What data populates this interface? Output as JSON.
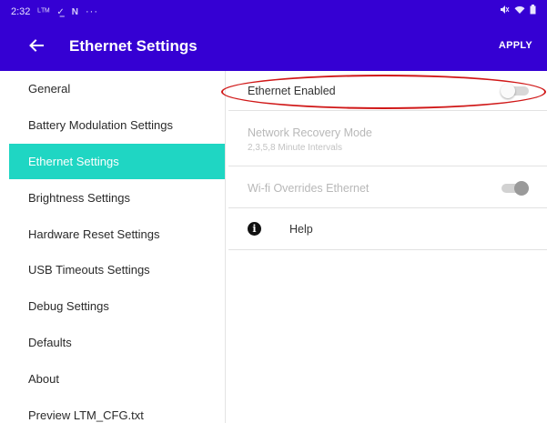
{
  "status_bar": {
    "time": "2:32",
    "indicators": [
      "ltm-icon",
      "check-download-icon",
      "n-icon",
      "more-dots-icon"
    ]
  },
  "app_bar": {
    "title": "Ethernet Settings",
    "apply_label": "APPLY",
    "color": "#3500d3"
  },
  "sidebar": {
    "active_color": "#1fd6c3",
    "items": [
      {
        "label": "General"
      },
      {
        "label": "Battery Modulation Settings"
      },
      {
        "label": "Ethernet Settings",
        "active": true
      },
      {
        "label": "Brightness Settings"
      },
      {
        "label": "Hardware Reset Settings"
      },
      {
        "label": "USB Timeouts Settings"
      },
      {
        "label": "Debug Settings"
      },
      {
        "label": "Defaults"
      },
      {
        "label": "About"
      },
      {
        "label": "Preview LTM_CFG.txt"
      }
    ]
  },
  "settings": {
    "ethernet_enabled": {
      "label": "Ethernet Enabled",
      "state": "off"
    },
    "network_recovery": {
      "label": "Network Recovery Mode",
      "subtitle": "2,3,5,8 Minute Intervals",
      "enabled": false
    },
    "wifi_overrides": {
      "label": "Wi-fi Overrides Ethernet",
      "state": "on",
      "enabled": false
    },
    "help": {
      "label": "Help"
    }
  },
  "annotation_color": "#d01818"
}
